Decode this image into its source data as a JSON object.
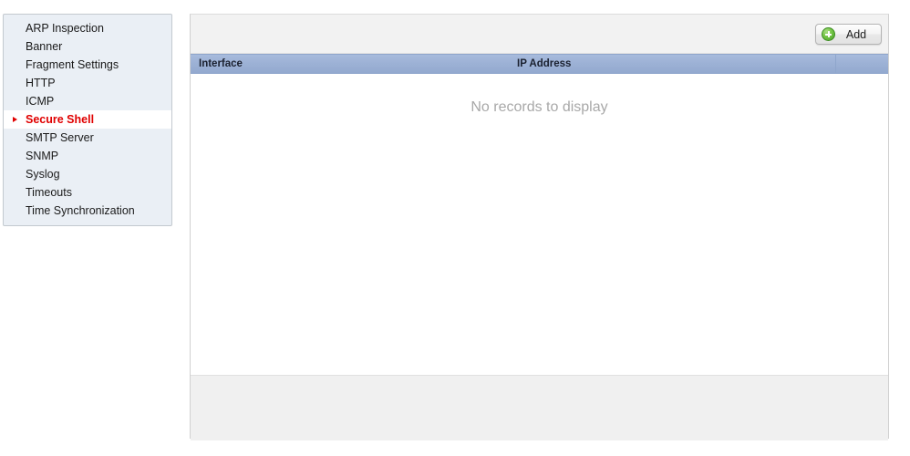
{
  "sidebar": {
    "items": [
      {
        "label": "ARP Inspection",
        "selected": false
      },
      {
        "label": "Banner",
        "selected": false
      },
      {
        "label": "Fragment Settings",
        "selected": false
      },
      {
        "label": "HTTP",
        "selected": false
      },
      {
        "label": "ICMP",
        "selected": false
      },
      {
        "label": "Secure Shell",
        "selected": true
      },
      {
        "label": "SMTP Server",
        "selected": false
      },
      {
        "label": "SNMP",
        "selected": false
      },
      {
        "label": "Syslog",
        "selected": false
      },
      {
        "label": "Timeouts",
        "selected": false
      },
      {
        "label": "Time Synchronization",
        "selected": false
      }
    ],
    "selected_marker_icon": "triangle-right-icon",
    "selected_color": "#e00000",
    "background_color": "#eaeff5"
  },
  "toolbar": {
    "add_label": "Add",
    "add_icon": "plus-circle-green-icon"
  },
  "table": {
    "columns": [
      {
        "header": "Interface"
      },
      {
        "header": "IP Address"
      }
    ],
    "rows": [],
    "empty_message": "No records to display",
    "header_background": "#9cb1d5",
    "empty_message_color": "#a8a8a8"
  }
}
